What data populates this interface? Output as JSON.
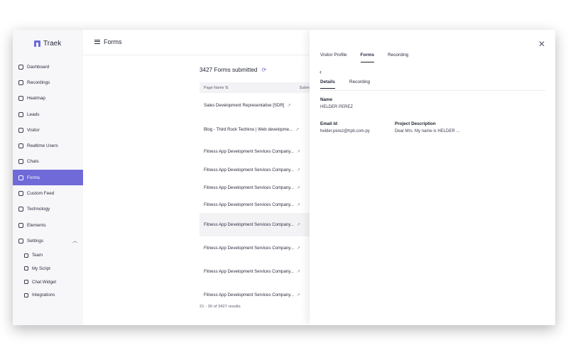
{
  "brand": "Traek",
  "sidebar": {
    "items": [
      {
        "label": "Dashboard"
      },
      {
        "label": "Recordings"
      },
      {
        "label": "Heatmap"
      },
      {
        "label": "Leads"
      },
      {
        "label": "Visitor"
      },
      {
        "label": "Realtime Users"
      },
      {
        "label": "Chats"
      },
      {
        "label": "Forms",
        "active": true
      },
      {
        "label": "Custom Feed"
      },
      {
        "label": "Technology"
      },
      {
        "label": "Elements"
      },
      {
        "label": "Settings"
      }
    ],
    "settings_sub": [
      {
        "label": "Team"
      },
      {
        "label": "My Script"
      },
      {
        "label": "Chat Widget"
      },
      {
        "label": "Integrations"
      }
    ]
  },
  "header": {
    "title": "Forms"
  },
  "main": {
    "submitted_text": "3427 Forms submitted",
    "columns": [
      "Page Name",
      "Submi"
    ],
    "rows": [
      {
        "text": "Sales Development Representative [SDR]"
      },
      {
        "text": "Blog - Third Rock Techkno | Web developme..."
      },
      {
        "text": "Fitness App Development Services Company..."
      },
      {
        "text": "Fitness App Development Services Company..."
      },
      {
        "text": "Fitness App Development Services Company..."
      },
      {
        "text": "Fitness App Development Services Company..."
      },
      {
        "text": "Fitness App Development Services Company..."
      },
      {
        "text": "Fitness App Development Services Company..."
      },
      {
        "text": "Fitness App Development Services Company..."
      },
      {
        "text": "Fitness App Development Services Company..."
      }
    ],
    "results": "21 - 30 of 3427 results"
  },
  "drawer": {
    "tabs": [
      "Visitor Profile",
      "Forms",
      "Recording"
    ],
    "active_tab": "Forms",
    "subtabs": [
      "Details",
      "Recording"
    ],
    "fields": {
      "name_label": "Name",
      "name_value": "HELDER PEREZ",
      "email_label": "Email Id",
      "email_value": "helder.perez@hpti.com.py",
      "project_label": "Project Description",
      "project_value": "Dear Mrs. My name is HELDER ..."
    }
  },
  "colors": {
    "accent": "#6f6ad8",
    "sidebar_bg": "#f7f7f9"
  }
}
